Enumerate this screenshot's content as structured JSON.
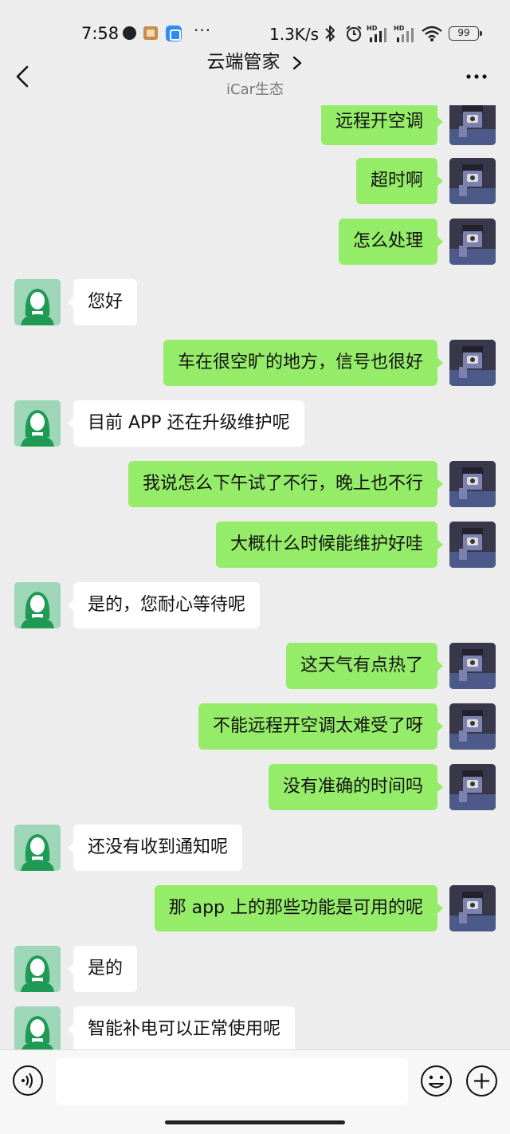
{
  "status_bar": {
    "time": "7:58",
    "more": "···",
    "net_speed": "1.3K/s",
    "signal_1_label": "HD",
    "signal_2_label": "HD",
    "battery": "99"
  },
  "header": {
    "title": "云端管家",
    "subtitle": "iCar生态"
  },
  "messages": [
    {
      "from": "user",
      "text": "远程开空调"
    },
    {
      "from": "user",
      "text": "超时啊"
    },
    {
      "from": "user",
      "text": "怎么处理"
    },
    {
      "from": "agent",
      "text": "您好"
    },
    {
      "from": "user",
      "text": "车在很空旷的地方，信号也很好"
    },
    {
      "from": "agent",
      "text": "目前 APP 还在升级维护呢"
    },
    {
      "from": "user",
      "text": "我说怎么下午试了不行，晚上也不行"
    },
    {
      "from": "user",
      "text": "大概什么时候能维护好哇"
    },
    {
      "from": "agent",
      "text": "是的，您耐心等待呢"
    },
    {
      "from": "user",
      "text": "这天气有点热了"
    },
    {
      "from": "user",
      "text": "不能远程开空调太难受了呀"
    },
    {
      "from": "user",
      "text": "没有准确的时间吗"
    },
    {
      "from": "agent",
      "text": "还没有收到通知呢"
    },
    {
      "from": "user",
      "text": "那 app 上的那些功能是可用的呢"
    },
    {
      "from": "agent",
      "text": "是的"
    },
    {
      "from": "agent",
      "text": "智能补电可以正常使用呢"
    }
  ],
  "input": {
    "value": "",
    "placeholder": ""
  },
  "icons": {
    "back": "back-arrow-icon",
    "title_chevron": "chevron-right-icon",
    "more": "more-dots-icon",
    "voice": "voice-icon",
    "emoji": "emoji-icon",
    "plus": "plus-icon"
  },
  "colors": {
    "background": "#ededed",
    "user_bubble": "#95ec69",
    "agent_bubble": "#ffffff",
    "agent_avatar_bg": "#9ed6b8",
    "agent_avatar_figure": "#1f9a55"
  }
}
